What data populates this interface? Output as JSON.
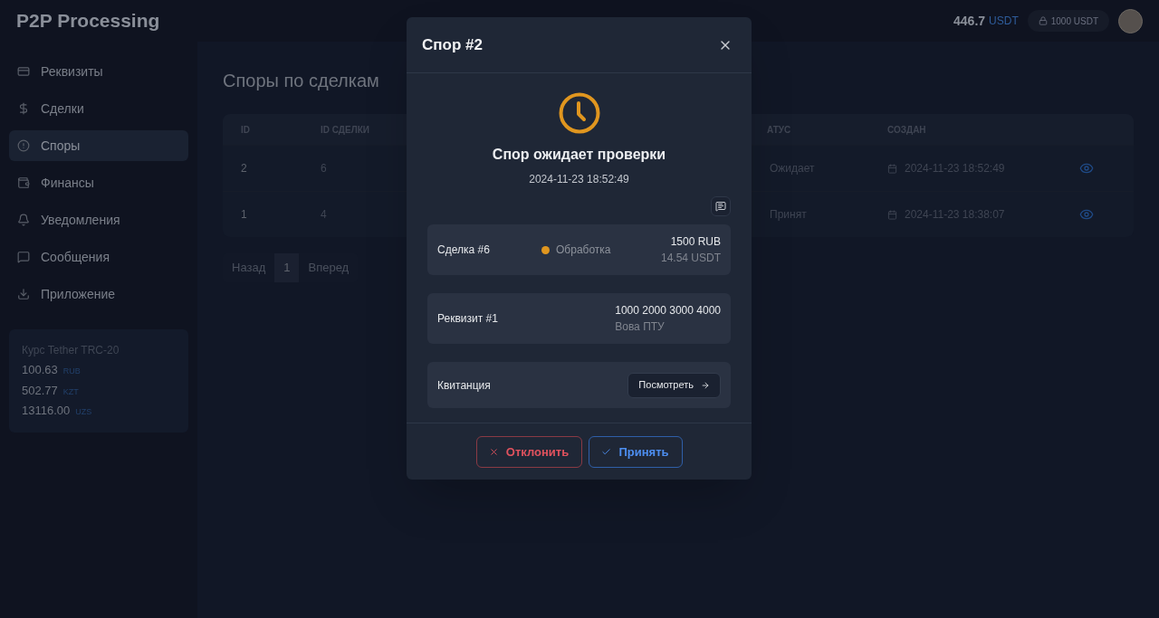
{
  "header": {
    "brand": "P2P Processing",
    "balance": "446.7",
    "balance_unit": "USDT",
    "frozen": "1000 USDT"
  },
  "sidebar": {
    "items": [
      {
        "label": "Реквизиты",
        "selected": false
      },
      {
        "label": "Сделки",
        "selected": false
      },
      {
        "label": "Споры",
        "selected": true
      },
      {
        "label": "Финансы",
        "selected": false
      },
      {
        "label": "Уведомления",
        "selected": false
      },
      {
        "label": "Сообщения",
        "selected": false
      },
      {
        "label": "Приложение",
        "selected": false
      }
    ],
    "rates": {
      "title": "Курс Tether TRC-20",
      "items": [
        {
          "value": "100.63",
          "unit": "RUB"
        },
        {
          "value": "502.77",
          "unit": "KZT"
        },
        {
          "value": "13116.00",
          "unit": "UZS"
        }
      ]
    }
  },
  "page": {
    "title": "Споры по сделкам",
    "table": {
      "columns": [
        "ID",
        "ID СДЕЛКИ",
        "АТУС",
        "СОЗДАН"
      ],
      "rows": [
        {
          "id": "2",
          "deal_id": "6",
          "status": "Ожидает",
          "created": "2024-11-23 18:52:49"
        },
        {
          "id": "1",
          "deal_id": "4",
          "status": "Принят",
          "created": "2024-11-23 18:38:07"
        }
      ]
    },
    "pagination": {
      "prev": "Назад",
      "pages": [
        {
          "label": "1",
          "selected": true
        }
      ],
      "next": "Вперед"
    }
  },
  "modal": {
    "title": "Спор #2",
    "status_title": "Спор ожидает проверки",
    "status_time": "2024-11-23 18:52:49",
    "deal": {
      "label": "Сделка #6",
      "status": "Обработка",
      "amount": "1500 RUB",
      "amount_usdt": "14.54 USDT"
    },
    "requisite": {
      "label": "Реквизит #1",
      "number": "1000 2000 3000 4000",
      "holder": "Вова ПТУ"
    },
    "receipt": {
      "label": "Квитанция",
      "button": "Посмотреть"
    },
    "buttons": [
      {
        "kind": "reject",
        "label": "Отклонить"
      },
      {
        "kind": "accept",
        "label": "Принять"
      }
    ]
  }
}
